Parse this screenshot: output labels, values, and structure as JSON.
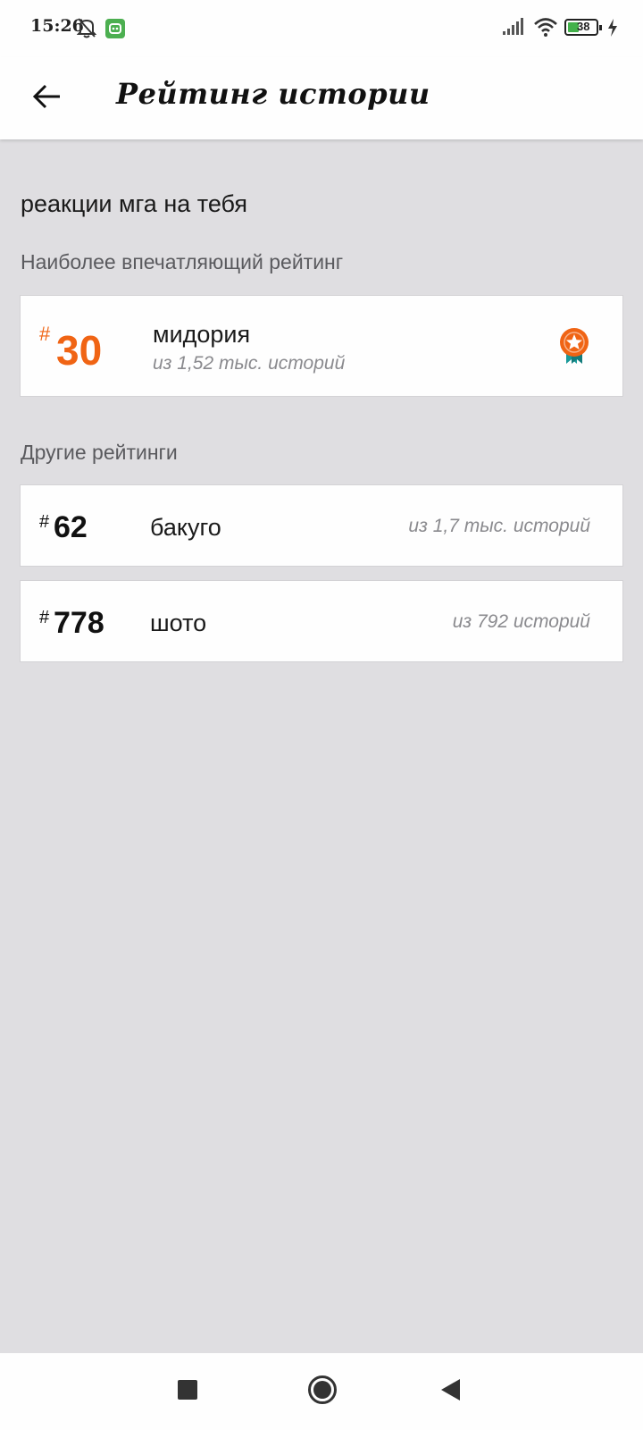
{
  "status_bar": {
    "time": "15:26",
    "battery_percent": "38",
    "icons": [
      "bell-off-icon",
      "app-notification-icon",
      "signal-icon",
      "wifi-icon",
      "battery-icon",
      "charging-icon"
    ]
  },
  "header": {
    "title": "Рейтинг истории",
    "back_icon": "arrow-left-icon"
  },
  "story": {
    "title": "реакции мга на тебя"
  },
  "top_ranking": {
    "section_label": "Наиболее впечатляющий рейтинг",
    "hash": "#",
    "rank": "30",
    "tag": "мидория",
    "of_count": "из 1,52 тыс. историй",
    "badge_icon": "award-medal-icon",
    "accent_color": "#f06414"
  },
  "other_rankings": {
    "section_label": "Другие рейтинги",
    "items": [
      {
        "hash": "#",
        "rank": "62",
        "tag": "бакуго",
        "of_count": "из 1,7 тыс. историй"
      },
      {
        "hash": "#",
        "rank": "778",
        "tag": "шото",
        "of_count": "из 792 историй"
      }
    ]
  },
  "nav_bar": {
    "icons": [
      "recent-apps-icon",
      "home-icon",
      "back-triangle-icon"
    ]
  }
}
